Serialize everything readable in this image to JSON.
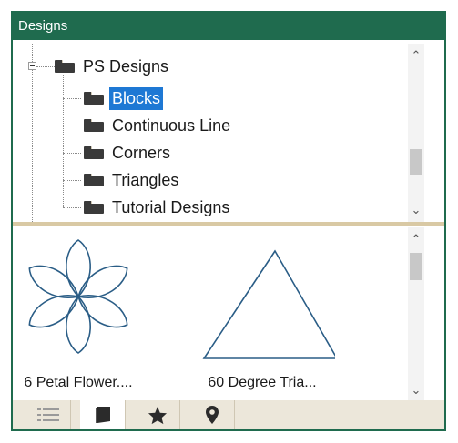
{
  "panel": {
    "title": "Designs"
  },
  "tree": {
    "root": {
      "label": "PS Designs",
      "expanded": true
    },
    "children": [
      {
        "label": "Blocks",
        "selected": true
      },
      {
        "label": "Continuous Line"
      },
      {
        "label": "Corners"
      },
      {
        "label": "Triangles"
      },
      {
        "label": "Tutorial Designs"
      }
    ]
  },
  "designs": [
    {
      "caption": "6 Petal Flower....",
      "icon": "six-petal-flower"
    },
    {
      "caption": "60 Degree Tria...",
      "icon": "equilateral-triangle"
    }
  ],
  "tabs": [
    {
      "name": "list-view",
      "icon": "list-icon",
      "active": false
    },
    {
      "name": "designs",
      "icon": "book-icon",
      "active": true
    },
    {
      "name": "favorites",
      "icon": "star-icon",
      "active": false
    },
    {
      "name": "locations",
      "icon": "location-pin-icon",
      "active": false
    }
  ],
  "colors": {
    "title_bar": "#1f6b4e",
    "selection": "#1e78d4",
    "design_stroke": "#2a5d86",
    "splitter": "#d9c9a4",
    "tab_bar": "#ece7da"
  }
}
